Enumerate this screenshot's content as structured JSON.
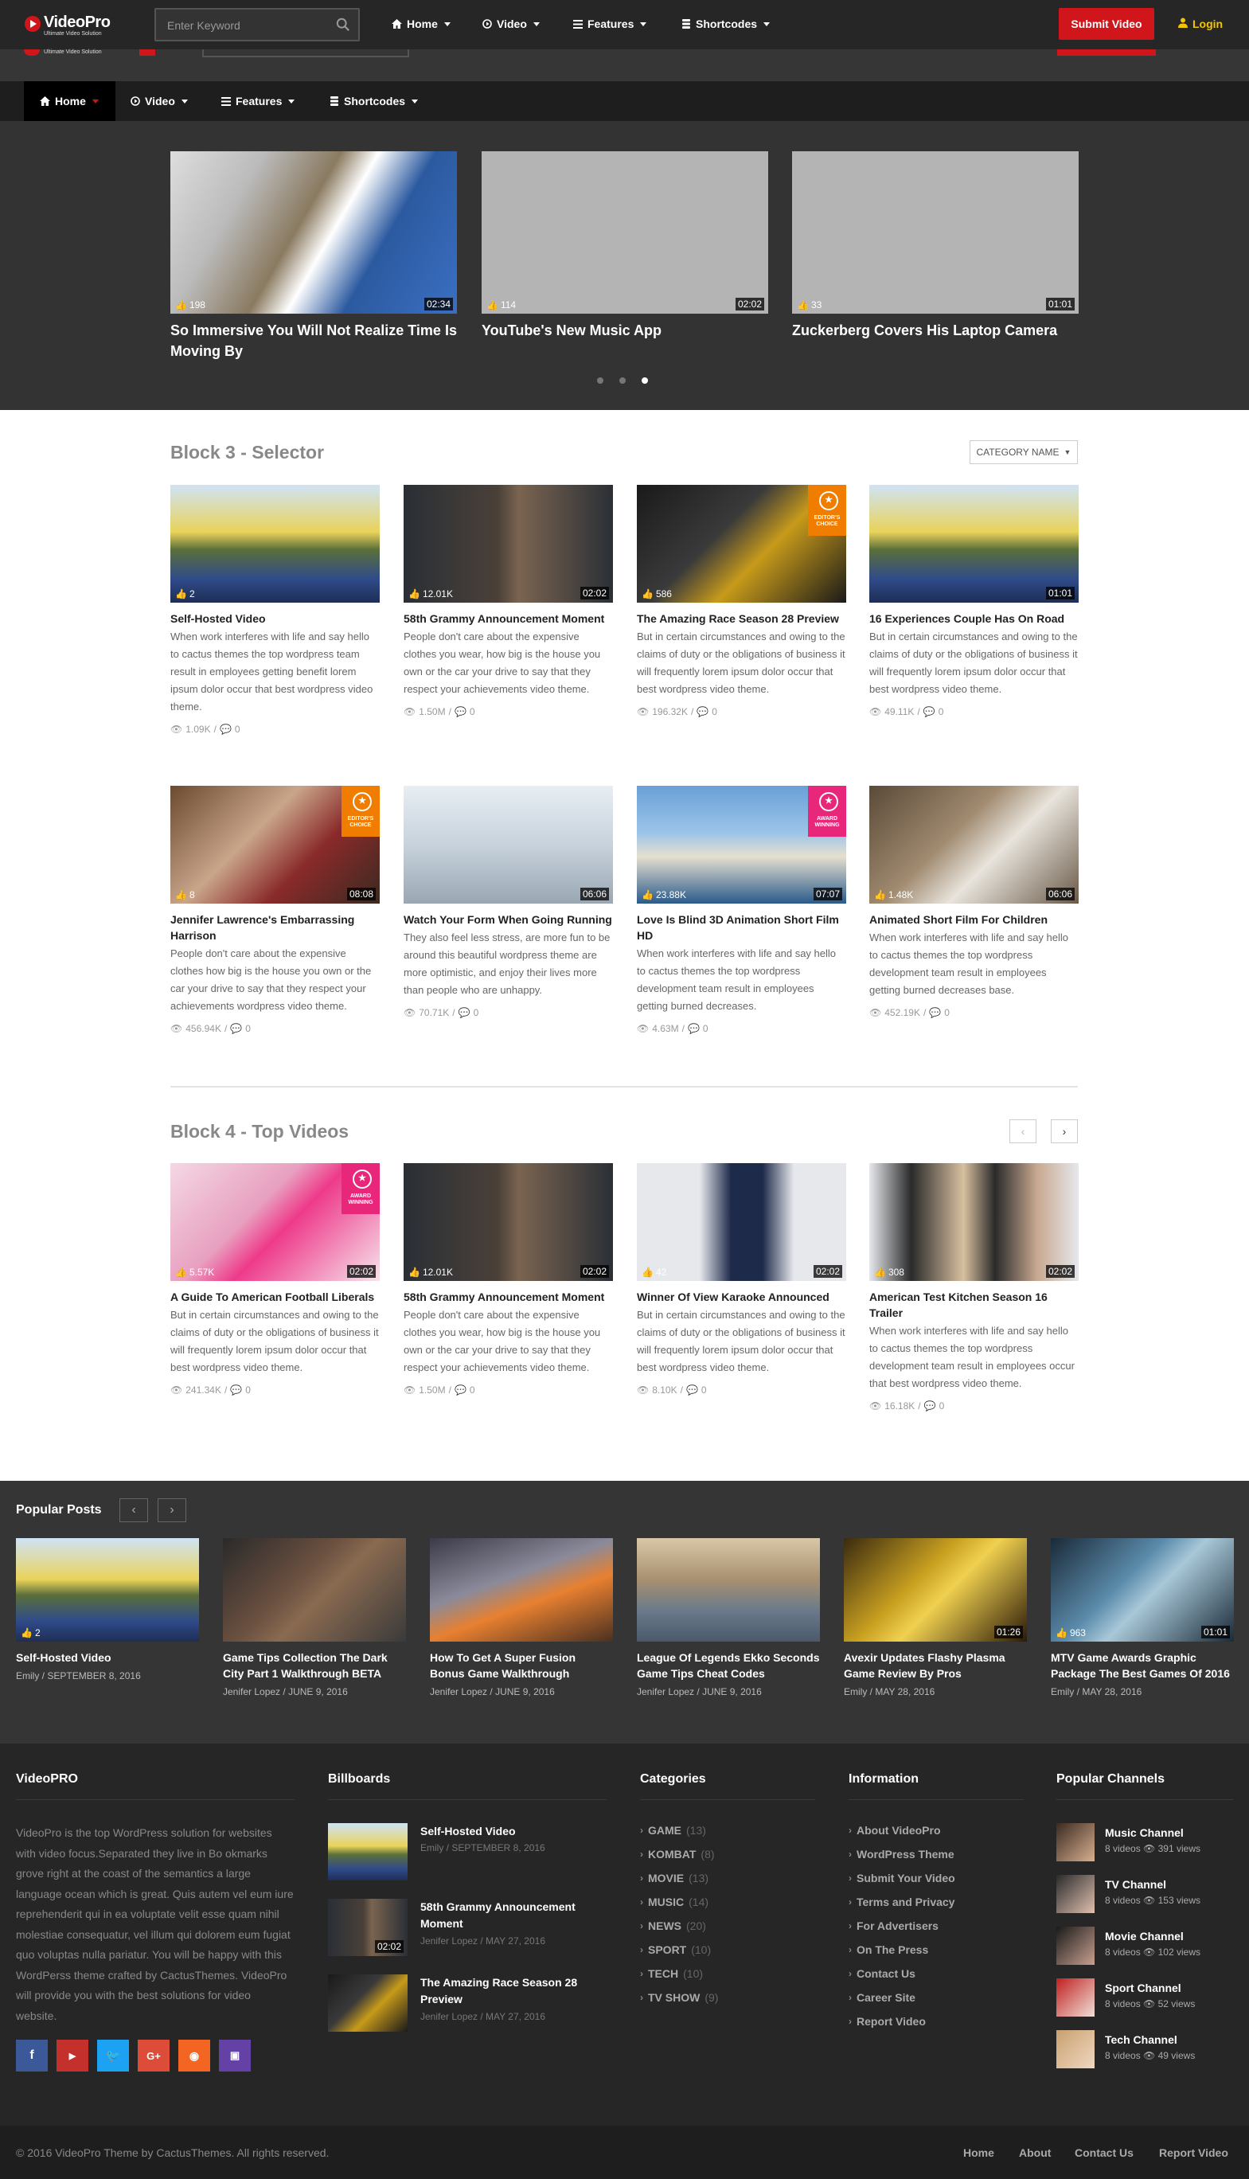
{
  "header": {
    "logo_text": "VideoPro",
    "logo_tagline": "Ultimate Video Solution",
    "search_placeholder": "Enter Keyword",
    "nav": [
      "Home",
      "Video",
      "Features",
      "Shortcodes"
    ],
    "submit_label": "Submit Video",
    "login_label": "Login"
  },
  "slider": {
    "slides": [
      {
        "title": "So Immersive You Will Not Realize Time Is Moving By",
        "likes": "198",
        "duration": "02:34"
      },
      {
        "title": "YouTube's New Music App",
        "likes": "114",
        "duration": "02:02"
      },
      {
        "title": "Zuckerberg Covers His Laptop Camera",
        "likes": "33",
        "duration": "01:01"
      }
    ]
  },
  "block3": {
    "title": "Block 3 - Selector",
    "category_label": "CATEGORY NAME",
    "cards": [
      {
        "title": "Self-Hosted Video",
        "excerpt": "When work interferes with life and say hello to cactus themes the top wordpress team result in employees getting benefit lorem ipsum dolor occur that best wordpress video theme.",
        "likes": "2",
        "duration": "",
        "views": "1.09K",
        "comments": "0"
      },
      {
        "title": "58th Grammy Announcement Moment",
        "excerpt": "People don't care about the expensive clothes you wear, how big is the house you own or the car your drive to say that they respect your achievements video theme.",
        "likes": "12.01K",
        "duration": "02:02",
        "views": "1.50M",
        "comments": "0"
      },
      {
        "title": "The Amazing Race Season 28 Preview",
        "excerpt": "But in certain circumstances and owing to the claims of duty or the obligations of business it will frequently lorem ipsum dolor occur that best wordpress video theme.",
        "likes": "586",
        "duration": "",
        "views": "196.32K",
        "comments": "0",
        "badge": "EDITOR'S CHOICE"
      },
      {
        "title": "16 Experiences Couple Has On Road",
        "excerpt": "But in certain circumstances and owing to the claims of duty or the obligations of business it will frequently lorem ipsum dolor occur that best wordpress video theme.",
        "likes": "",
        "duration": "01:01",
        "views": "49.11K",
        "comments": "0"
      },
      {
        "title": "Jennifer Lawrence's Embarrassing Harrison",
        "excerpt": "People don't care about the expensive clothes how big is the house you own or the car your drive to say that they respect your achievements wordpress video theme.",
        "likes": "8",
        "duration": "08:08",
        "views": "456.94K",
        "comments": "0",
        "badge": "EDITOR'S CHOICE"
      },
      {
        "title": "Watch Your Form When Going Running",
        "excerpt": "They also feel less stress, are more fun to be around this beautiful wordpress theme are more optimistic, and enjoy their lives more than people who are unhappy.",
        "likes": "",
        "duration": "06:06",
        "views": "70.71K",
        "comments": "0"
      },
      {
        "title": "Love Is Blind 3D Animation Short Film HD",
        "excerpt": "When work interferes with life and say hello to cactus themes the top wordpress development team result in employees getting burned decreases.",
        "likes": "23.88K",
        "duration": "07:07",
        "views": "4.63M",
        "comments": "0",
        "badge": "AWARD WINNING"
      },
      {
        "title": "Animated Short Film For Children",
        "excerpt": "When work interferes with life and say hello to cactus themes the top wordpress development team result in employees getting burned decreases base.",
        "likes": "1.48K",
        "duration": "06:06",
        "views": "452.19K",
        "comments": "0"
      }
    ]
  },
  "block4": {
    "title": "Block 4 - Top Videos",
    "cards": [
      {
        "title": "A Guide To American Football Liberals",
        "excerpt": "But in certain circumstances and owing to the claims of duty or the obligations of business it will frequently lorem ipsum dolor occur that best wordpress video theme.",
        "likes": "5.57K",
        "duration": "02:02",
        "views": "241.34K",
        "comments": "0",
        "badge": "AWARD WINNING"
      },
      {
        "title": "58th Grammy Announcement Moment",
        "excerpt": "People don't care about the expensive clothes you wear, how big is the house you own or the car your drive to say that they respect your achievements video theme.",
        "likes": "12.01K",
        "duration": "02:02",
        "views": "1.50M",
        "comments": "0"
      },
      {
        "title": "Winner Of View Karaoke Announced",
        "excerpt": "But in certain circumstances and owing to the claims of duty or the obligations of business it will frequently lorem ipsum dolor occur that best wordpress video theme.",
        "likes": "42",
        "duration": "02:02",
        "views": "8.10K",
        "comments": "0"
      },
      {
        "title": "American Test Kitchen Season 16 Trailer",
        "excerpt": "When work interferes with life and say hello to cactus themes the top wordpress development team result in employees occur that best wordpress video theme.",
        "likes": "308",
        "duration": "02:02",
        "views": "16.18K",
        "comments": "0"
      }
    ]
  },
  "popular": {
    "title": "Popular Posts",
    "posts": [
      {
        "title": "Self-Hosted Video",
        "author": "Emily",
        "date": "SEPTEMBER 8, 2016",
        "likes": "2",
        "duration": ""
      },
      {
        "title": "Game Tips Collection The Dark City Part 1 Walkthrough BETA",
        "author": "Jenifer Lopez",
        "date": "JUNE 9, 2016",
        "likes": "",
        "duration": ""
      },
      {
        "title": "How To Get A Super Fusion Bonus Game Walkthrough",
        "author": "Jenifer Lopez",
        "date": "JUNE 9, 2016",
        "likes": "",
        "duration": ""
      },
      {
        "title": "League Of Legends Ekko Seconds Game Tips Cheat Codes",
        "author": "Jenifer Lopez",
        "date": "JUNE 9, 2016",
        "likes": "",
        "duration": ""
      },
      {
        "title": "Avexir Updates Flashy Plasma Game Review By Pros",
        "author": "Emily",
        "date": "MAY 28, 2016",
        "likes": "",
        "duration": "01:26"
      },
      {
        "title": "MTV Game Awards Graphic Package The Best Games Of 2016",
        "author": "Emily",
        "date": "MAY 28, 2016",
        "likes": "963",
        "duration": "01:01"
      }
    ]
  },
  "footer": {
    "about_title": "VideoPRO",
    "about_text": "VideoPro is the top WordPress solution for websites with video focus.Separated they live in Bo okmarks grove right at the coast of the semantics a large language ocean which is great. Quis autem vel eum iure reprehenderit qui in ea voluptate velit esse quam nihil molestiae consequatur, vel illum qui dolorem eum fugiat quo voluptas nulla pariatur. You will be happy with this WordPerss theme crafted by CactusThemes. VideoPro will provide you with the best solutions for video website.",
    "billboards_title": "Billboards",
    "billboards": [
      {
        "title": "Self-Hosted Video",
        "meta": "Emily  /  SEPTEMBER 8, 2016",
        "duration": ""
      },
      {
        "title": "58th Grammy Announcement Moment",
        "meta": "Jenifer Lopez  /  MAY 27, 2016",
        "duration": "02:02"
      },
      {
        "title": "The Amazing Race Season 28 Preview",
        "meta": "Jenifer Lopez  /  MAY 27, 2016",
        "duration": ""
      }
    ],
    "categories_title": "Categories",
    "categories": [
      {
        "name": "GAME",
        "count": "(13)"
      },
      {
        "name": "KOMBAT",
        "count": "(8)"
      },
      {
        "name": "MOVIE",
        "count": "(13)"
      },
      {
        "name": "MUSIC",
        "count": "(14)"
      },
      {
        "name": "NEWS",
        "count": "(20)"
      },
      {
        "name": "SPORT",
        "count": "(10)"
      },
      {
        "name": "TECH",
        "count": "(10)"
      },
      {
        "name": "TV SHOW",
        "count": "(9)"
      }
    ],
    "information_title": "Information",
    "information": [
      "About VideoPro",
      "WordPress Theme",
      "Submit Your Video",
      "Terms and Privacy",
      "For Advertisers",
      "On The Press",
      "Contact Us",
      "Career Site",
      "Report Video"
    ],
    "channels_title": "Popular Channels",
    "channels": [
      {
        "name": "Music Channel",
        "videos": "8 videos",
        "views": "391 views"
      },
      {
        "name": "TV Channel",
        "videos": "8 videos",
        "views": "153 views"
      },
      {
        "name": "Movie Channel",
        "videos": "8 videos",
        "views": "102 views"
      },
      {
        "name": "Sport Channel",
        "videos": "8 videos",
        "views": "52 views"
      },
      {
        "name": "Tech Channel",
        "videos": "8 videos",
        "views": "49 views"
      }
    ],
    "copyright": "© 2016 VideoPro Theme by CactusThemes. All rights reserved.",
    "bottom_links": [
      "Home",
      "About",
      "Contact Us",
      "Report Video"
    ]
  },
  "colors": {
    "accent": "#d0161b",
    "login": "#f2c500",
    "editor_badge": "#f07c00",
    "award_badge": "#e8267a"
  }
}
